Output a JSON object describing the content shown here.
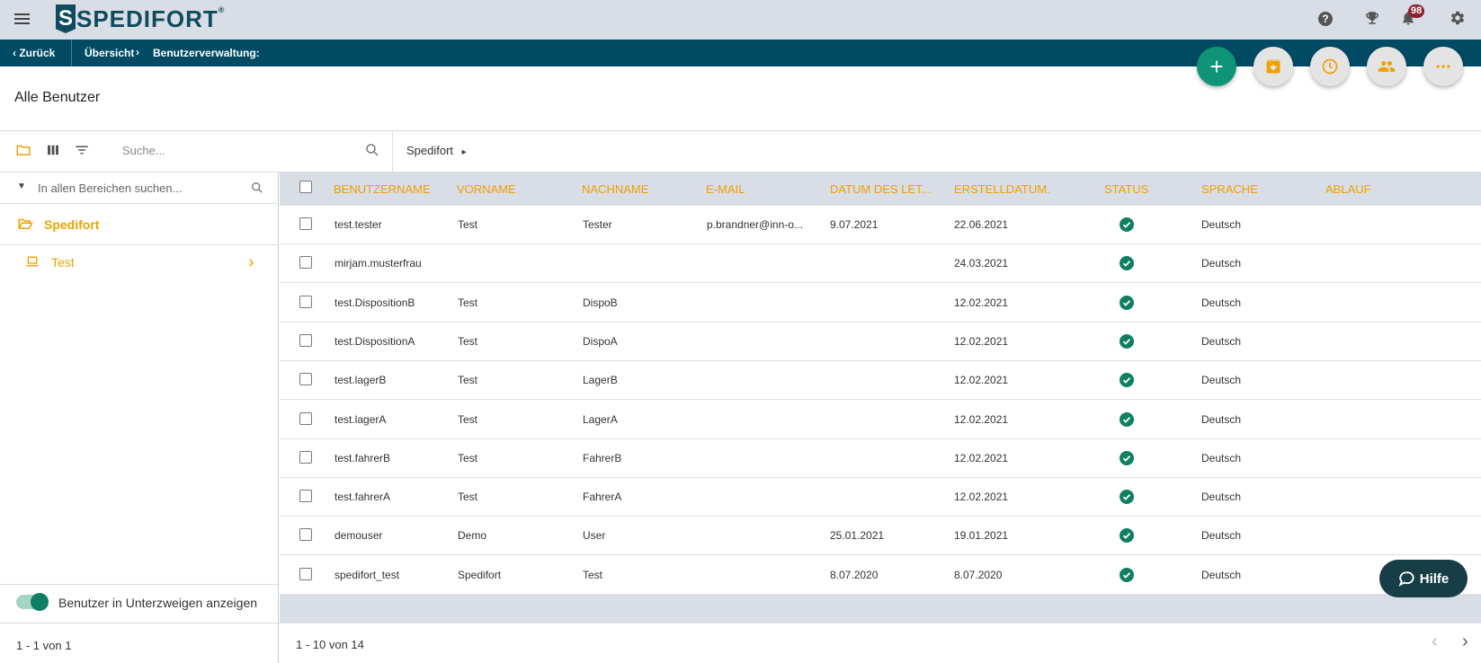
{
  "app": {
    "logo_text": "SPEDIFORT",
    "logo_letter": "S",
    "notifications_count": "98"
  },
  "nav": {
    "back_label": "Zurück",
    "crumb1": "Übersicht",
    "crumb2": "Benutzerverwaltung:"
  },
  "page": {
    "title": "Alle Benutzer"
  },
  "toolbar": {
    "search_placeholder": "Suche...",
    "breadcrumb": "Spedifort"
  },
  "sidebar": {
    "search_placeholder": "In allen Bereichen suchen...",
    "items": [
      {
        "label": "Spedifort",
        "icon": "folder-open-icon"
      },
      {
        "label": "Test",
        "icon": "laptop-icon"
      }
    ],
    "toggle_label": "Benutzer in Unterzweigen anzeigen",
    "toggle_on": true,
    "pagination": "1 - 1 von 1"
  },
  "table": {
    "columns": [
      "BENUTZERNAME",
      "VORNAME",
      "NACHNAME",
      "E-MAIL",
      "DATUM DES LET...",
      "ERSTELLDATUM...",
      "STATUS",
      "SPRACHE",
      "ABLAUF"
    ],
    "rows": [
      {
        "username": "test.tester",
        "first": "Test",
        "last": "Tester",
        "email": "p.brandner@inn-o...",
        "lastdate": "9.07.2021",
        "created": "22.06.2021",
        "lang": "Deutsch"
      },
      {
        "username": "mirjam.musterfrau",
        "first": "",
        "last": "",
        "email": "",
        "lastdate": "",
        "created": "24.03.2021",
        "lang": "Deutsch"
      },
      {
        "username": "test.DispositionB",
        "first": "Test",
        "last": "DispoB",
        "email": "",
        "lastdate": "",
        "created": "12.02.2021",
        "lang": "Deutsch"
      },
      {
        "username": "test.DispositionA",
        "first": "Test",
        "last": "DispoA",
        "email": "",
        "lastdate": "",
        "created": "12.02.2021",
        "lang": "Deutsch"
      },
      {
        "username": "test.lagerB",
        "first": "Test",
        "last": "LagerB",
        "email": "",
        "lastdate": "",
        "created": "12.02.2021",
        "lang": "Deutsch"
      },
      {
        "username": "test.lagerA",
        "first": "Test",
        "last": "LagerA",
        "email": "",
        "lastdate": "",
        "created": "12.02.2021",
        "lang": "Deutsch"
      },
      {
        "username": "test.fahrerB",
        "first": "Test",
        "last": "FahrerB",
        "email": "",
        "lastdate": "",
        "created": "12.02.2021",
        "lang": "Deutsch"
      },
      {
        "username": "test.fahrerA",
        "first": "Test",
        "last": "FahrerA",
        "email": "",
        "lastdate": "",
        "created": "12.02.2021",
        "lang": "Deutsch"
      },
      {
        "username": "demouser",
        "first": "Demo",
        "last": "User",
        "email": "",
        "lastdate": "25.01.2021",
        "created": "19.01.2021",
        "lang": "Deutsch"
      },
      {
        "username": "spedifort_test",
        "first": "Spedifort",
        "last": "Test",
        "email": "",
        "lastdate": "8.07.2020",
        "created": "8.07.2020",
        "lang": "Deutsch"
      }
    ],
    "pagination": "1 - 10 von 14"
  },
  "help_button": {
    "label": "Hilfe"
  },
  "colors": {
    "accent": "#f0a000",
    "navbar": "#004a63",
    "green": "#0f9478",
    "header_bg": "#d9dde6"
  }
}
